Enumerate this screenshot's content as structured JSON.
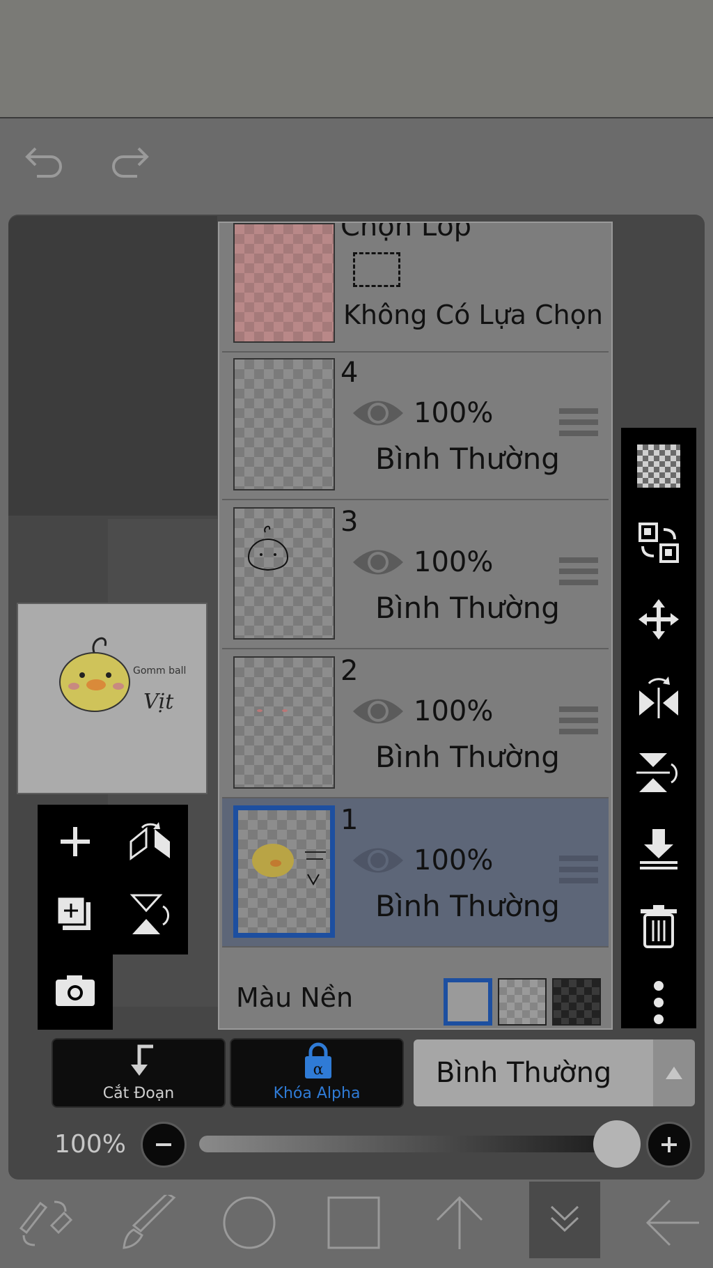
{
  "layers_panel": {
    "selection_layer": {
      "title": "Chọn Lớp",
      "status": "Không Có Lựa Chọn"
    },
    "layers": [
      {
        "number": "4",
        "opacity": "100%",
        "blend": "Bình Thường",
        "selected": false
      },
      {
        "number": "3",
        "opacity": "100%",
        "blend": "Bình Thường",
        "selected": false
      },
      {
        "number": "2",
        "opacity": "100%",
        "blend": "Bình Thường",
        "selected": false
      },
      {
        "number": "1",
        "opacity": "100%",
        "blend": "Bình Thường",
        "selected": true
      }
    ],
    "background_color": {
      "label": "Màu Nền",
      "options": [
        "white",
        "checker-light",
        "checker-dark"
      ],
      "selected": "white"
    }
  },
  "bottom_controls": {
    "clipping_label": "Cắt Đoạn",
    "alpha_lock_label": "Khóa Alpha",
    "blend_mode": "Bình Thường",
    "opacity_label": "100%",
    "opacity_value": 1.0
  },
  "preview_art": {
    "text_line1": "Gomm ball",
    "text_line2": "Vịt"
  },
  "colors": {
    "selected_border": "#1d4fa0",
    "alpha_lock_accent": "#2f7bd6",
    "selected_row": "#5d6678"
  },
  "icons": {
    "top": [
      "undo-icon",
      "redo-icon"
    ],
    "left_tools": [
      "add-layer-icon",
      "flip-horizontal-icon",
      "duplicate-layer-icon",
      "flip-vertical-icon",
      "camera-icon"
    ],
    "right_tools": [
      "transparency-icon",
      "swap-icon",
      "move-icon",
      "flip-horizontal-icon",
      "flip-vertical-icon",
      "merge-down-icon",
      "trash-icon",
      "more-icon"
    ],
    "bottom": [
      "transform-icon",
      "brush-icon",
      "circle-icon",
      "square-icon",
      "up-arrow-icon",
      "collapse-icon",
      "back-icon"
    ]
  }
}
